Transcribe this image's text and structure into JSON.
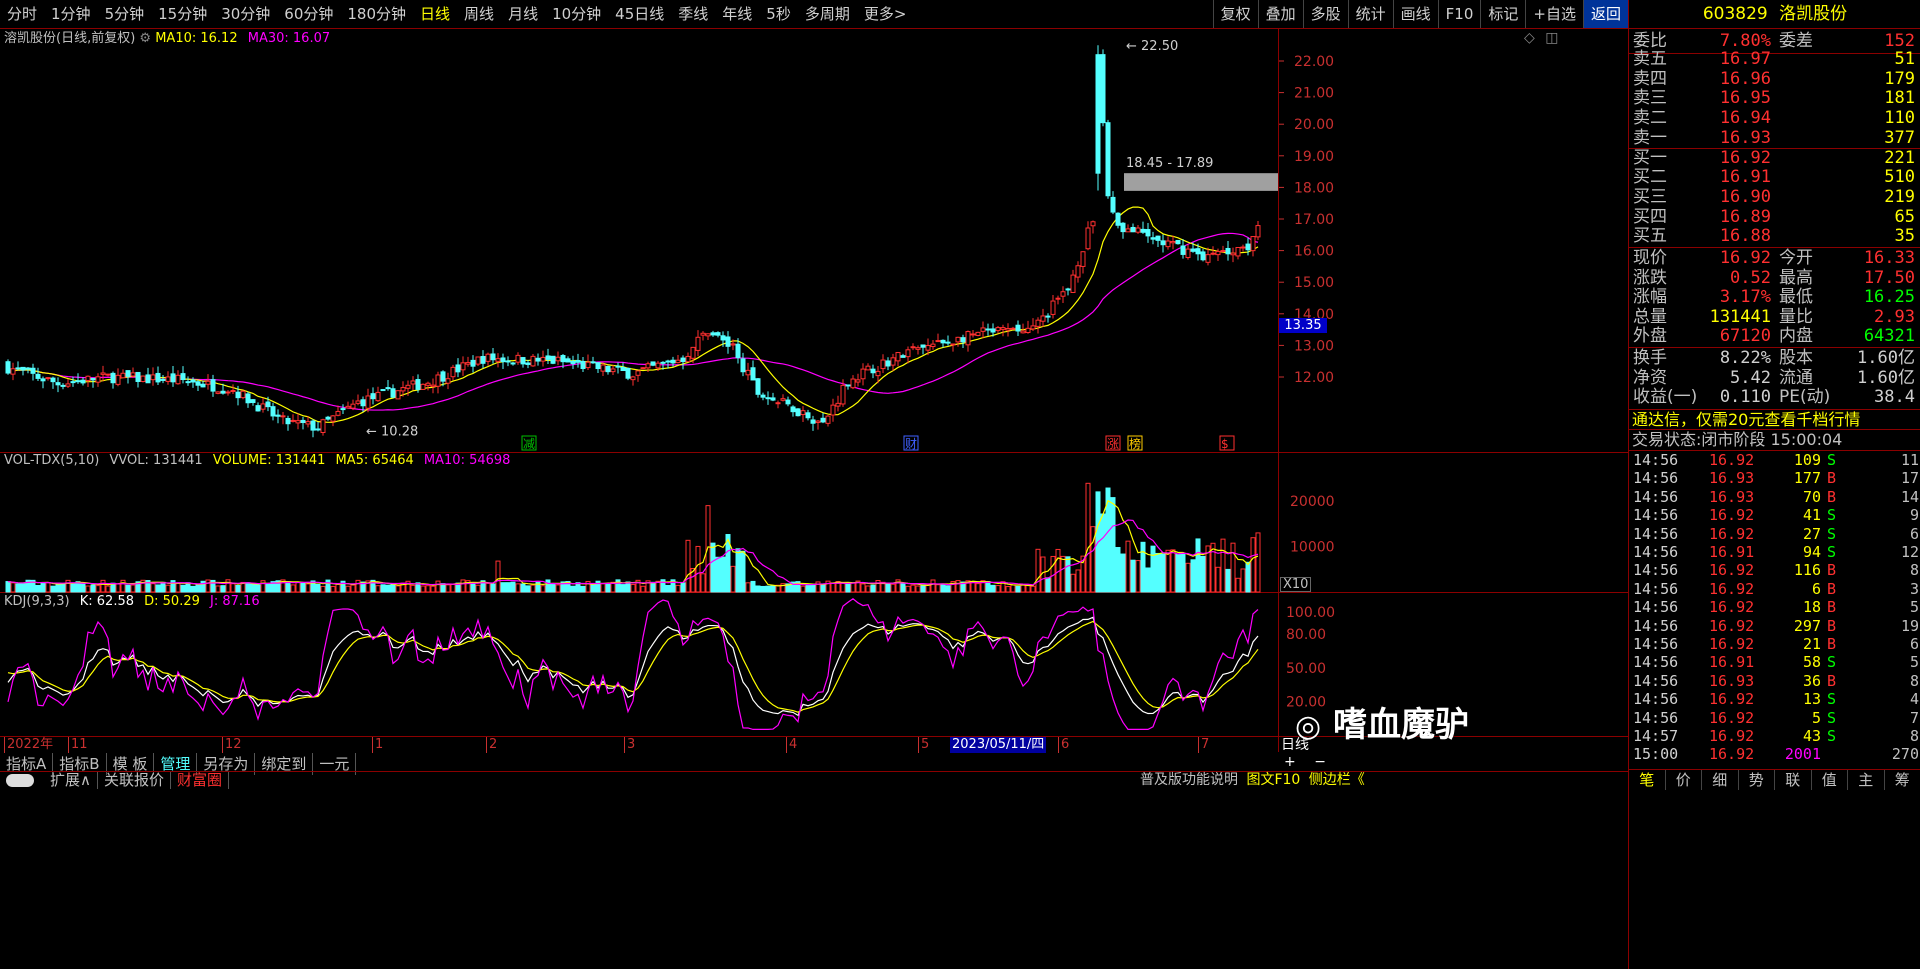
{
  "toolbar": {
    "periods": [
      "分时",
      "1分钟",
      "5分钟",
      "15分钟",
      "30分钟",
      "60分钟",
      "180分钟",
      "日线",
      "周线",
      "月线",
      "10分钟",
      "45日线",
      "季线",
      "年线",
      "5秒",
      "多周期",
      "更多>"
    ],
    "active_period": "日线",
    "tools": [
      "复权",
      "叠加",
      "多股",
      "统计",
      "画线",
      "F10",
      "标记",
      "+自选",
      "返回"
    ]
  },
  "main_chart": {
    "title": "溶凯股份(日线,前复权)",
    "ma10": "MA10: 16.12",
    "ma30": "MA30: 16.07",
    "y_ticks": [
      "22.00",
      "21.00",
      "20.00",
      "19.00",
      "18.00",
      "17.00",
      "16.00",
      "15.00",
      "14.00",
      "13.00",
      "12.00"
    ],
    "price_tag": "13.35",
    "high_label": "22.50",
    "low_label": "10.28",
    "gap_label": "18.45 - 17.89",
    "markers": [
      "减",
      "财",
      "涨",
      "榜",
      "$"
    ]
  },
  "vol_chart": {
    "title": "VOL-TDX(5,10)",
    "vvol": "VVOL: 131441",
    "volume": "VOLUME: 131441",
    "ma5": "MA5: 65464",
    "ma10": "MA10: 54698",
    "y_ticks": [
      "20000",
      "10000"
    ],
    "unit": "X10"
  },
  "kdj_chart": {
    "title": "KDJ(9,3,3)",
    "k": "K: 62.58",
    "d": "D: 50.29",
    "j": "J: 87.16",
    "y_ticks": [
      "100.00",
      "80.00",
      "50.00",
      "20.00"
    ]
  },
  "x_axis": {
    "labels": [
      "2022年",
      "11",
      "12",
      "1",
      "2",
      "3",
      "4",
      "5",
      "6",
      "7"
    ],
    "highlight": "2023/05/11/四",
    "period": "日线"
  },
  "bottom": {
    "row1": [
      "指标A",
      "指标B",
      "模 板",
      "管理",
      "另存为",
      "绑定到",
      "一元"
    ],
    "row2": [
      "扩展∧",
      "关联报价",
      "财富圈"
    ],
    "right_text": "普及版功能说明",
    "f10": "图文F10",
    "sidebar": "侧边栏《"
  },
  "quote": {
    "code": "603829",
    "name": "洛凯股份",
    "weibi_label": "委比",
    "weibi": "7.80%",
    "weicha_label": "委差",
    "weicha": "152",
    "asks": [
      {
        "label": "卖五",
        "price": "16.97",
        "vol": "51"
      },
      {
        "label": "卖四",
        "price": "16.96",
        "vol": "179"
      },
      {
        "label": "卖三",
        "price": "16.95",
        "vol": "181"
      },
      {
        "label": "卖二",
        "price": "16.94",
        "vol": "110"
      },
      {
        "label": "卖一",
        "price": "16.93",
        "vol": "377"
      }
    ],
    "bids": [
      {
        "label": "买一",
        "price": "16.92",
        "vol": "221"
      },
      {
        "label": "买二",
        "price": "16.91",
        "vol": "510"
      },
      {
        "label": "买三",
        "price": "16.90",
        "vol": "219"
      },
      {
        "label": "买四",
        "price": "16.89",
        "vol": "65"
      },
      {
        "label": "买五",
        "price": "16.88",
        "vol": "35"
      }
    ],
    "stats": [
      {
        "l1": "现价",
        "v1": "16.92",
        "l2": "今开",
        "v2": "16.33",
        "c1": "#ff3030",
        "c2": "#ff3030"
      },
      {
        "l1": "涨跌",
        "v1": "0.52",
        "l2": "最高",
        "v2": "17.50",
        "c1": "#ff3030",
        "c2": "#ff3030"
      },
      {
        "l1": "涨幅",
        "v1": "3.17%",
        "l2": "最低",
        "v2": "16.25",
        "c1": "#ff3030",
        "c2": "#00ff00"
      },
      {
        "l1": "总量",
        "v1": "131441",
        "l2": "量比",
        "v2": "2.93",
        "c1": "#ffff00",
        "c2": "#ff3030"
      },
      {
        "l1": "外盘",
        "v1": "67120",
        "l2": "内盘",
        "v2": "64321",
        "c1": "#ff3030",
        "c2": "#00ff00"
      },
      {
        "l1": "换手",
        "v1": "8.22%",
        "l2": "股本",
        "v2": "1.60亿",
        "c1": "#d0d0d0",
        "c2": "#d0d0d0"
      },
      {
        "l1": "净资",
        "v1": "5.42",
        "l2": "流通",
        "v2": "1.60亿",
        "c1": "#d0d0d0",
        "c2": "#d0d0d0"
      },
      {
        "l1": "收益(一)",
        "v1": "0.110",
        "l2": "PE(动)",
        "v2": "38.4",
        "c1": "#d0d0d0",
        "c2": "#d0d0d0"
      }
    ],
    "promo": "通达信，仅需20元查看千档行情",
    "trade_status": "交易状态:闭市阶段 15:00:04",
    "ticks": [
      {
        "t": "14:56",
        "p": "16.92",
        "v": "109",
        "s": "S",
        "n": "11"
      },
      {
        "t": "14:56",
        "p": "16.93",
        "v": "177",
        "s": "B",
        "n": "17"
      },
      {
        "t": "14:56",
        "p": "16.93",
        "v": "70",
        "s": "B",
        "n": "14"
      },
      {
        "t": "14:56",
        "p": "16.92",
        "v": "41",
        "s": "S",
        "n": "9"
      },
      {
        "t": "14:56",
        "p": "16.92",
        "v": "27",
        "s": "S",
        "n": "6"
      },
      {
        "t": "14:56",
        "p": "16.91",
        "v": "94",
        "s": "S",
        "n": "12"
      },
      {
        "t": "14:56",
        "p": "16.92",
        "v": "116",
        "s": "B",
        "n": "8"
      },
      {
        "t": "14:56",
        "p": "16.92",
        "v": "6",
        "s": "B",
        "n": "3"
      },
      {
        "t": "14:56",
        "p": "16.92",
        "v": "18",
        "s": "B",
        "n": "5"
      },
      {
        "t": "14:56",
        "p": "16.92",
        "v": "297",
        "s": "B",
        "n": "19"
      },
      {
        "t": "14:56",
        "p": "16.92",
        "v": "21",
        "s": "B",
        "n": "6"
      },
      {
        "t": "14:56",
        "p": "16.91",
        "v": "58",
        "s": "S",
        "n": "5"
      },
      {
        "t": "14:56",
        "p": "16.93",
        "v": "36",
        "s": "B",
        "n": "8"
      },
      {
        "t": "14:56",
        "p": "16.92",
        "v": "13",
        "s": "S",
        "n": "4"
      },
      {
        "t": "14:56",
        "p": "16.92",
        "v": "5",
        "s": "S",
        "n": "7"
      },
      {
        "t": "14:57",
        "p": "16.92",
        "v": "43",
        "s": "S",
        "n": "8"
      },
      {
        "t": "15:00",
        "p": "16.92",
        "v": "2001",
        "s": "",
        "n": "270"
      }
    ],
    "footer_tabs": [
      "笔",
      "价",
      "细",
      "势",
      "联",
      "值",
      "主",
      "筹"
    ]
  },
  "watermark": "嗜血魔驴"
}
